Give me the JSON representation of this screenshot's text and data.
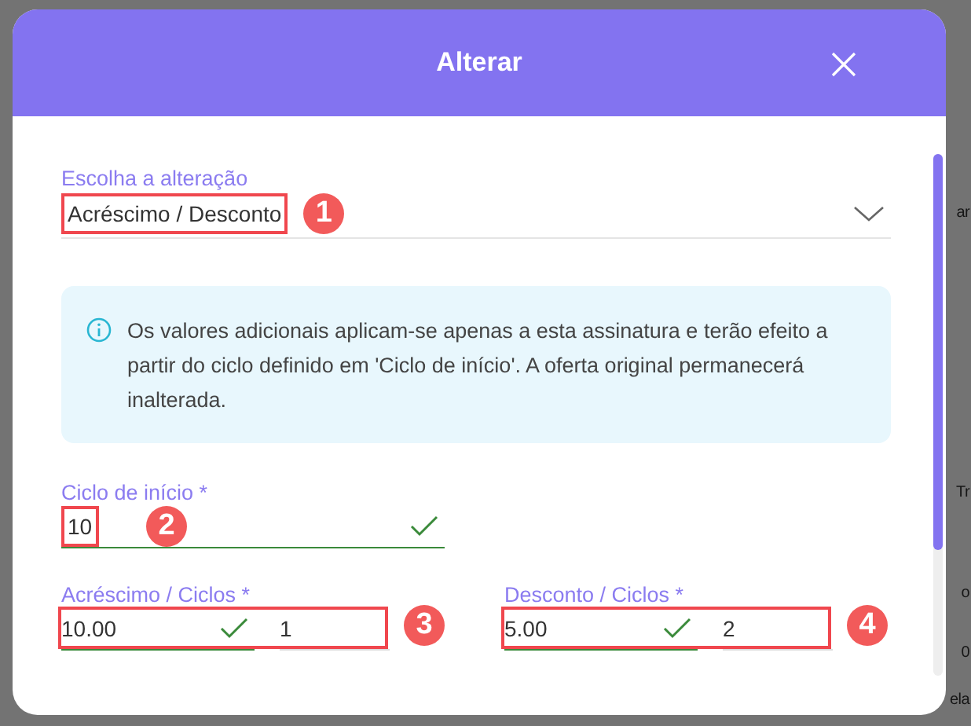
{
  "background_texts": [
    "ar",
    "Tr",
    "o",
    "0",
    "ela"
  ],
  "dialog": {
    "title": "Alterar"
  },
  "change_select": {
    "label": "Escolha a alteração",
    "value": "Acréscimo / Desconto",
    "marker": "1"
  },
  "info": {
    "text": "Os valores adicionais aplicam-se apenas a esta assinatura e terão efeito a partir do ciclo definido em 'Ciclo de início'. A oferta original permanecerá inalterada."
  },
  "start_cycle": {
    "label": "Ciclo de início *",
    "value": "10",
    "valid": true,
    "marker": "2"
  },
  "adjustments": [
    {
      "label": "Acréscimo / Ciclos *",
      "amount": "10.00",
      "amount_valid": true,
      "cycles": "1",
      "marker": "3"
    },
    {
      "label": "Desconto / Ciclos *",
      "amount": "5.00",
      "amount_valid": true,
      "cycles": "2",
      "marker": "4"
    }
  ]
}
